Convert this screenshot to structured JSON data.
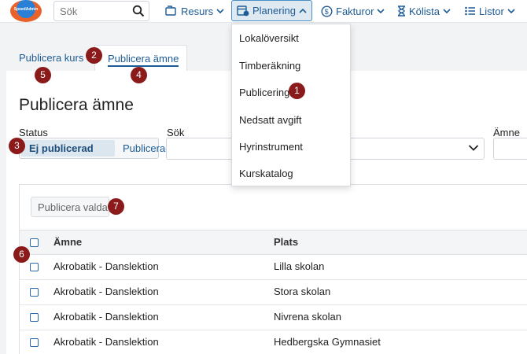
{
  "nav": {
    "logo_text": "SpeedAdmin",
    "search_placeholder": "Sök",
    "items": [
      {
        "label": "Resurs",
        "icon": "folders-icon"
      },
      {
        "label": "Planering",
        "icon": "calendar-clock-icon"
      },
      {
        "label": "Fakturor",
        "icon": "dollar-circle-icon"
      },
      {
        "label": "Kölista",
        "icon": "hourglass-icon"
      },
      {
        "label": "Listor",
        "icon": "list-icon"
      }
    ]
  },
  "dropdown": {
    "items": [
      "Lokalöversikt",
      "Timberäkning",
      "Publicering",
      "Nedsatt avgift",
      "Hyrinstrument",
      "Kurskatalog"
    ]
  },
  "tabs": [
    "Publicera kurs",
    "Publicera ämne"
  ],
  "page": {
    "title": "Publicera ämne",
    "status_label": "Status",
    "status_options": [
      "Ej publicerad",
      "Publicerad"
    ],
    "search_label": "Sök",
    "subject_label": "Ämne",
    "publish_button": "Publicera valda"
  },
  "table": {
    "columns": [
      "Ämne",
      "Plats"
    ],
    "rows": [
      [
        "Akrobatik - Danslektion",
        "Lilla skolan"
      ],
      [
        "Akrobatik - Danslektion",
        "Stora skolan"
      ],
      [
        "Akrobatik - Danslektion",
        "Nivrena skolan"
      ],
      [
        "Akrobatik - Danslektion",
        "Hedbergska Gymnasiet"
      ]
    ]
  },
  "badges": [
    "1",
    "2",
    "3",
    "4",
    "5",
    "6",
    "7"
  ],
  "colors": {
    "accent": "#1d5b95",
    "badge": "#8b1a1a",
    "active_nav_bg": "#dfe9f2"
  }
}
